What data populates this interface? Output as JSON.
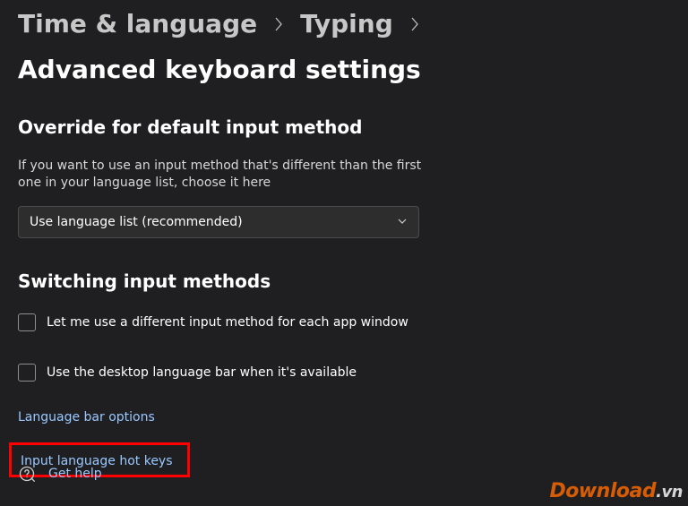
{
  "breadcrumb": {
    "item0": "Time & language",
    "item1": "Typing",
    "current": "Advanced keyboard settings"
  },
  "override": {
    "heading": "Override for default input method",
    "description": "If you want to use an input method that's different than the first one in your language list, choose it here",
    "dropdown_value": "Use language list (recommended)"
  },
  "switching": {
    "heading": "Switching input methods",
    "checkbox1_label": "Let me use a different input method for each app window",
    "checkbox2_label": "Use the desktop language bar when it's available"
  },
  "links": {
    "language_bar_options": "Language bar options",
    "input_language_hotkeys": "Input language hot keys"
  },
  "help": {
    "label": "Get help"
  },
  "watermark": {
    "brand": "Download",
    "tld": ".vn"
  }
}
